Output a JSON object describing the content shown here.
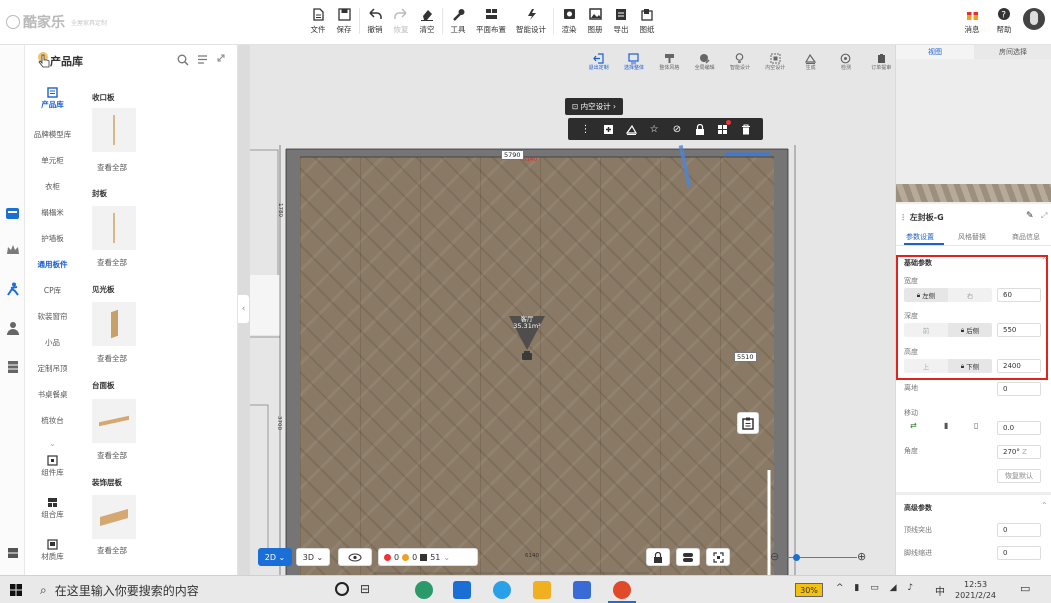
{
  "app": {
    "logo": "酷家乐",
    "logo_sub": "全屋家具定制"
  },
  "toolbar": [
    {
      "label": "文件",
      "icon": "file-icon"
    },
    {
      "label": "保存",
      "icon": "save-icon"
    },
    {
      "label": "撤销",
      "icon": "undo-icon"
    },
    {
      "label": "恢复",
      "icon": "redo-icon",
      "disabled": true
    },
    {
      "label": "清空",
      "icon": "eraser-icon"
    },
    {
      "label": "工具",
      "icon": "wrench-icon"
    },
    {
      "label": "平面布置",
      "icon": "layout-icon"
    },
    {
      "label": "智能设计",
      "icon": "smart-icon"
    },
    {
      "label": "渲染",
      "icon": "render-icon"
    },
    {
      "label": "图册",
      "icon": "album-icon"
    },
    {
      "label": "导出",
      "icon": "export-icon"
    },
    {
      "label": "图纸",
      "icon": "drawing-icon"
    }
  ],
  "header_right": [
    {
      "label": "消息",
      "icon": "gift-icon"
    },
    {
      "label": "帮助",
      "icon": "help-icon"
    }
  ],
  "panel": {
    "title": "产品库",
    "nav": [
      "产品库",
      "品牌模型库",
      "单元柜",
      "衣柜",
      "榻榻米",
      "护墙板",
      "通用板件",
      "CP库",
      "软装窗帘",
      "小品",
      "定制吊顶",
      "书桌餐桌",
      "梳妆台"
    ],
    "nav_bottom": [
      "组件库",
      "组合库",
      "材质库"
    ],
    "sections": [
      {
        "title": "收口板",
        "link": "查看全部"
      },
      {
        "title": "封板",
        "link": "查看全部"
      },
      {
        "title": "见光板",
        "link": "查看全部"
      },
      {
        "title": "台面板",
        "link": "查看全部"
      },
      {
        "title": "装饰层板",
        "link": "查看全部"
      }
    ]
  },
  "subtool": [
    {
      "label": "退出定制",
      "active": true
    },
    {
      "label": "选择整体",
      "active": true
    },
    {
      "label": "整体风格"
    },
    {
      "label": "全局编辑"
    },
    {
      "label": "智能设计"
    },
    {
      "label": "内空设计"
    },
    {
      "label": "生成"
    },
    {
      "label": "检测"
    },
    {
      "label": "订单提审"
    }
  ],
  "scene": {
    "inner_design": "内空设计",
    "dims": {
      "top": "5790",
      "top_red": "5140",
      "right": "5510",
      "left_top": "1780",
      "left_bottom": "3700",
      "bottom": "6140"
    },
    "camera_label": "客厅",
    "camera_area": "35.31m²",
    "view_2d": "2D",
    "view_3d": "3D",
    "status": {
      "errors": "0",
      "warnings": "0",
      "count": "51"
    }
  },
  "right": {
    "tabs": [
      "视图",
      "房间选择"
    ],
    "title": "左封板-G",
    "subtabs": [
      "参数设置",
      "风格替换",
      "商品信息"
    ],
    "basic": "基础参数",
    "width": {
      "label": "宽度",
      "left": "左侧",
      "right": "右",
      "value": "60"
    },
    "depth": {
      "label": "深度",
      "front": "前",
      "back": "后侧",
      "value": "550"
    },
    "height": {
      "label": "高度",
      "up": "上",
      "down": "下侧",
      "value": "2400"
    },
    "offground": {
      "label": "离地",
      "value": "0"
    },
    "move": {
      "label": "移动",
      "value": "0.0"
    },
    "angle": {
      "label": "角度",
      "value": "270°",
      "unit": "Z",
      "reset": "恢复默认"
    },
    "advanced": "高级参数",
    "adv_rows": [
      {
        "label": "顶线突出",
        "value": "0"
      },
      {
        "label": "脚线缩进",
        "value": "0"
      }
    ]
  },
  "taskbar": {
    "search": "在这里输入你要搜索的内容",
    "battery": "30%",
    "ime": "中",
    "time": "12:53",
    "date": "2021/2/24"
  }
}
